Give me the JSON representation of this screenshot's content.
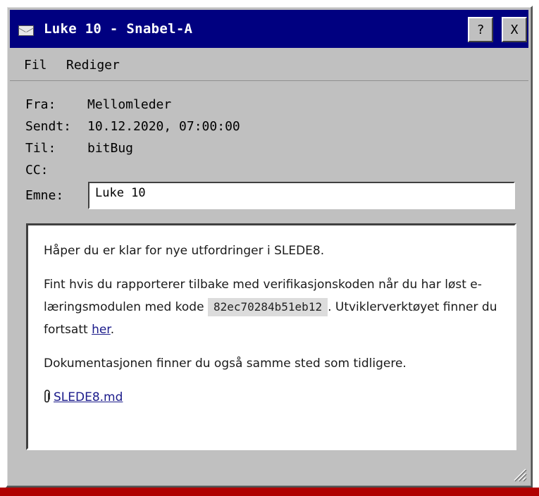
{
  "window": {
    "title": "Luke 10 - Snabel-A",
    "help_label": "?",
    "close_label": "X"
  },
  "menu": {
    "items": [
      "Fil",
      "Rediger"
    ]
  },
  "header": {
    "from_label": "Fra:",
    "from_value": "Mellomleder",
    "sent_label": "Sendt:",
    "sent_value": "10.12.2020, 07:00:00",
    "to_label": "Til:",
    "to_value": "bitBug",
    "cc_label": "CC:",
    "subject_label": "Emne:",
    "subject_value": "Luke 10"
  },
  "message": {
    "p1": "Håper du er klar for nye utfordringer i SLEDE8.",
    "p2_part1": "Fint hvis du rapporterer tilbake med verifikasjonskoden når du har løst e-læringsmodulen med kode",
    "code": "82ec70284b51eb12",
    "p2_part2": ". Utviklerverktøyet finner du fortsatt",
    "link_text": "her",
    "p2_end": ".",
    "p3": "Dokumentasjonen finner du også samme sted som tidligere.",
    "attachment": "SLEDE8.md"
  },
  "colors": {
    "titlebar": "#000080",
    "window_bg": "#c0c0c0",
    "link": "#1a1a8a",
    "desktop_accent": "#b00000"
  }
}
